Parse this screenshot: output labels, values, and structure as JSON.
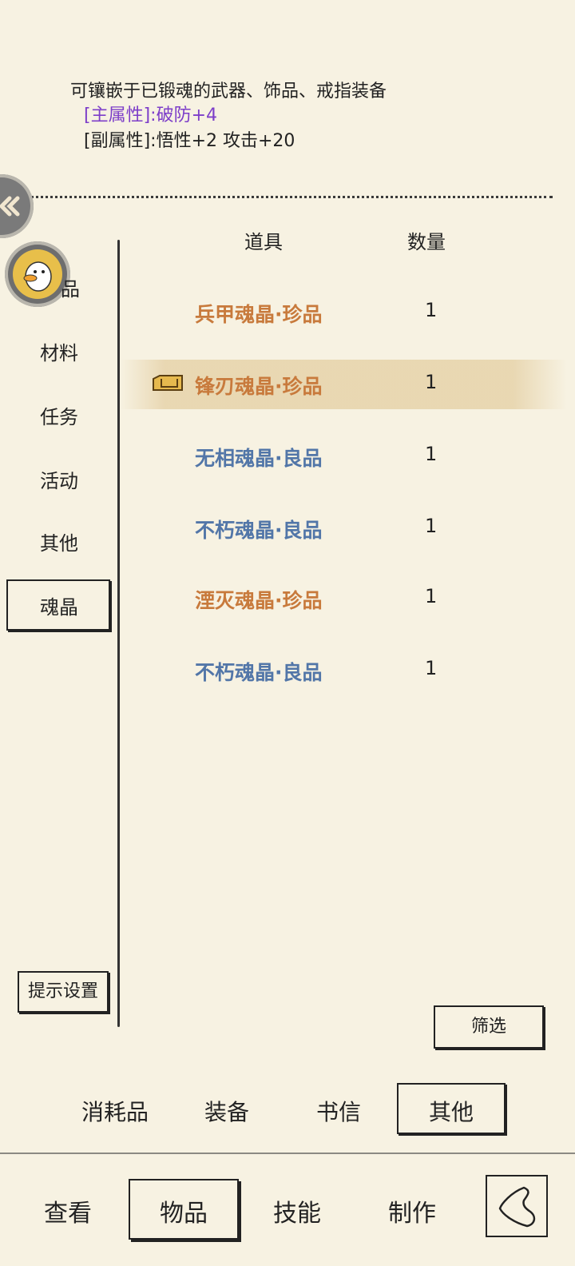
{
  "description": {
    "line1": "可镶嵌于已锻魂的武器、饰品、戒指装备",
    "main_attr_label": "[主属性]:破防+4",
    "sub_attr_label": "[副属性]:悟性+2 攻击+20"
  },
  "sidebar": {
    "categories": [
      {
        "label": "品"
      },
      {
        "label": "材料"
      },
      {
        "label": "任务"
      },
      {
        "label": "活动"
      },
      {
        "label": "其他"
      },
      {
        "label": "魂晶"
      }
    ],
    "active": "魂晶",
    "hint_settings": "提示设置"
  },
  "table": {
    "col_item": "道具",
    "col_qty": "数量",
    "rows": [
      {
        "name": "兵甲魂晶·珍品",
        "qty": "1",
        "quality": "rare",
        "color": "#c87a3c"
      },
      {
        "name": "锋刃魂晶·珍品",
        "qty": "1",
        "quality": "rare",
        "color": "#c87a3c",
        "selected": true
      },
      {
        "name": "无相魂晶·良品",
        "qty": "1",
        "quality": "good",
        "color": "#5276a8"
      },
      {
        "name": "不朽魂晶·良品",
        "qty": "1",
        "quality": "good",
        "color": "#5276a8"
      },
      {
        "name": "湮灭魂晶·珍品",
        "qty": "1",
        "quality": "rare",
        "color": "#c87a3c"
      },
      {
        "name": "不朽魂晶·良品",
        "qty": "1",
        "quality": "good",
        "color": "#5276a8"
      }
    ]
  },
  "filter_label": "筛选",
  "subtabs": {
    "items": [
      "消耗品",
      "装备",
      "书信",
      "其他"
    ],
    "active": "其他"
  },
  "nav": {
    "items": [
      "查看",
      "物品",
      "技能",
      "制作"
    ],
    "active": "物品"
  },
  "icons": {
    "top_circle": "double-chevron-icon",
    "avatar": "duck-avatar-icon",
    "selected_item": "equipped-crystal-icon",
    "back": "back-arrow-icon"
  }
}
